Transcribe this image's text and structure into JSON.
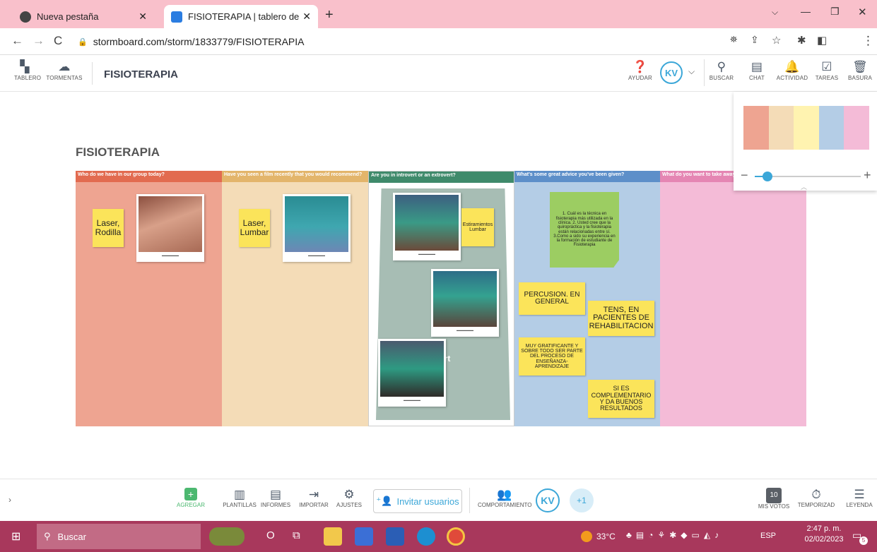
{
  "browser": {
    "tabs": [
      {
        "label": "Nueva pestaña",
        "active": false
      },
      {
        "label": "FISIOTERAPIA | tablero de tormen",
        "active": true
      }
    ],
    "new_tab": "+",
    "url": "stormboard.com/storm/1833779/FISIOTERAPIA"
  },
  "appbar": {
    "left_tools": [
      "TABLERO",
      "TORMENTAS"
    ],
    "title": "FISIOTERAPIA",
    "help": "AYUDAR",
    "avatar": "KV",
    "right_tools": [
      "BUSCAR",
      "CHAT",
      "ACTIVIDAD",
      "TAREAS",
      "BASURA"
    ]
  },
  "board": {
    "title": "FISIOTERAPIA",
    "columns": [
      {
        "title": "Who do we have in our group today?",
        "color": "#e26b50"
      },
      {
        "title": "Have you seen a film recently that you would recommend?",
        "color": "#e3b56b"
      },
      {
        "title": "Are you in introvert or an extrovert?",
        "color": "#3f8a6b"
      },
      {
        "title": "What's some great advice you've been given?",
        "color": "#5d8fc9"
      },
      {
        "title": "What do you want to take away fr",
        "color": "#e586b3"
      }
    ],
    "stickies": {
      "s1": "Laser, Rodilla",
      "s2": "Laser, Lumbar",
      "s3": "Estiramientos Lumbar",
      "s4": "1. Cuál es la técnica en fisioterapia más utilizada en la clínica. 2. Usted cree que la quiropráctica y la fisioterapia están relacionadas entre sí. 3.Como a sido su experiencia en la formación de estudiante de Fisioterapia",
      "s5": "PERCUSION. EN GENERAL",
      "s6": "TENS, EN PACIENTES DE REHABILITACION",
      "s7": "MUY GRATIFICANTE Y SOBRE TODO SER PARTE DEL PROCESO DE ENSEÑANZA- APRENDIZAJE",
      "s8": "SI ES COMPLEMENTARIO Y DA BUENOS RESULTADOS"
    },
    "hidden_text": "ert"
  },
  "minimap": {
    "zoom_minus": "−",
    "zoom_plus": "+",
    "zoom_level": 0.12
  },
  "bottombar": {
    "tools": [
      "AGREGAR",
      "PLANTILLAS",
      "INFORMES",
      "IMPORTAR",
      "AJUSTES"
    ],
    "invite": "Invitar usuarios",
    "behavior": "COMPORTAMIENTO",
    "avatar": "KV",
    "more_users": "+1",
    "votes_count": "10",
    "right_tools": [
      "MIS VOTOS",
      "TEMPORIZAD",
      "LEYENDA"
    ]
  },
  "taskbar": {
    "search": "Buscar",
    "temperature": "33°C",
    "lang": "ESP",
    "time": "2:47 p. m.",
    "date": "02/02/2023",
    "notif": "5"
  }
}
